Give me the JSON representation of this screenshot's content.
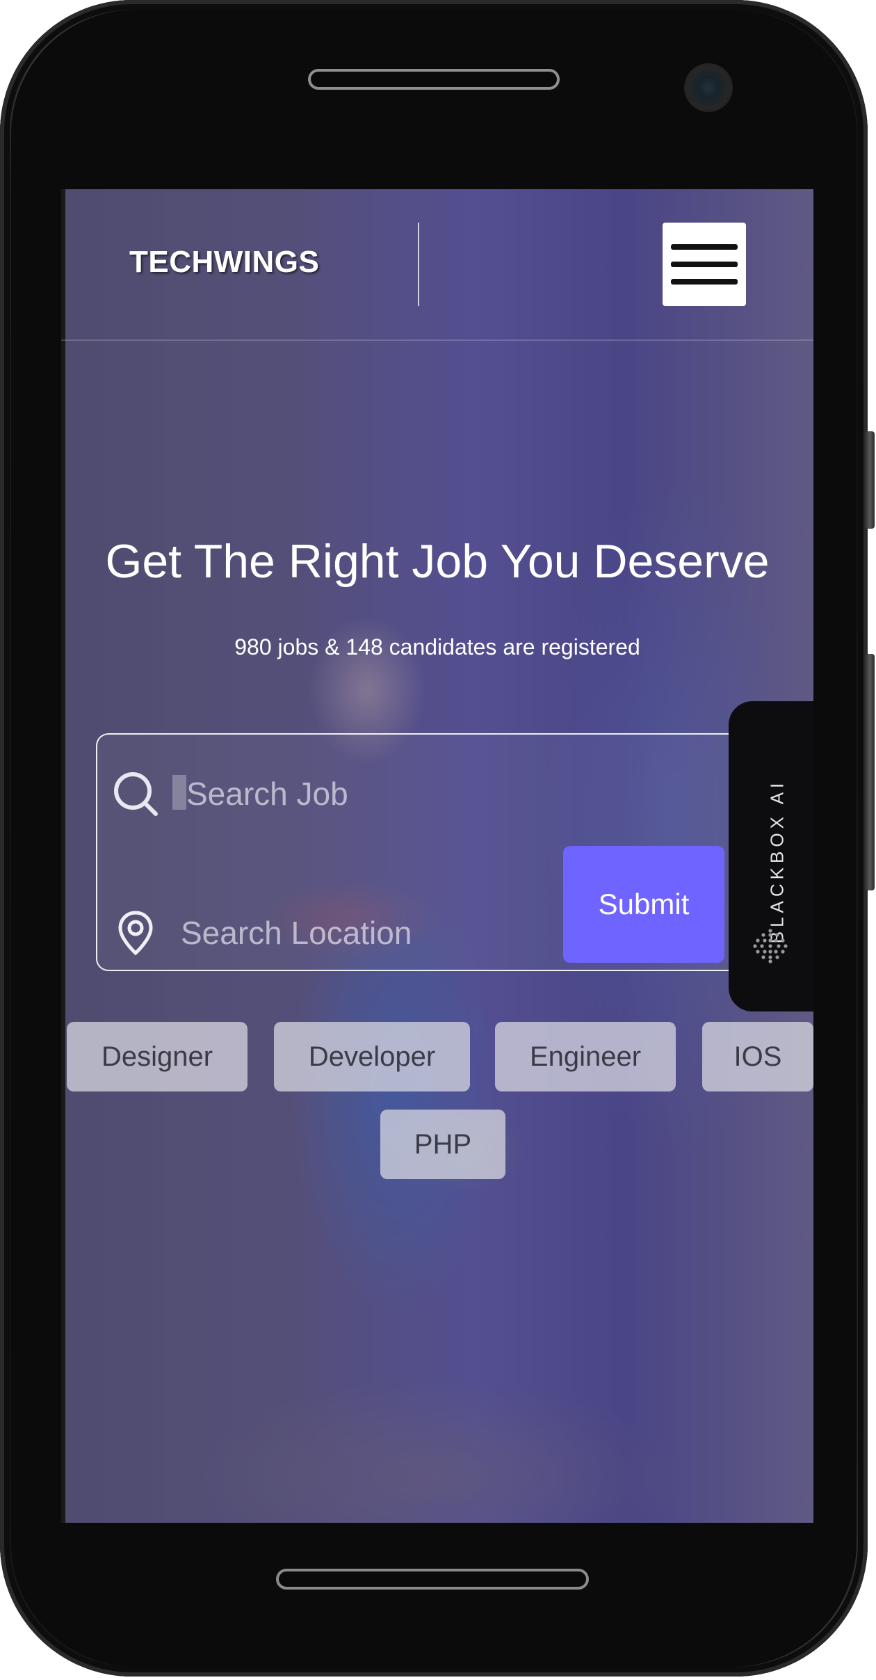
{
  "header": {
    "brand": "TECHWINGS",
    "menu_icon": "hamburger-menu-icon"
  },
  "hero": {
    "title": "Get The Right Job You Deserve",
    "subtitle": "980 jobs & 148 candidates are registered"
  },
  "search": {
    "job_placeholder": "Search Job",
    "location_placeholder": "Search Location",
    "job_icon": "search-icon",
    "location_icon": "location-pin-icon",
    "submit_label": "Submit",
    "submit_color": "#6f64ff"
  },
  "tags": [
    "Designer",
    "Developer",
    "Engineer",
    "IOS",
    "PHP"
  ],
  "floating_tab": {
    "label": "BLACKBOX AI",
    "icon": "blackbox-logo-icon"
  }
}
